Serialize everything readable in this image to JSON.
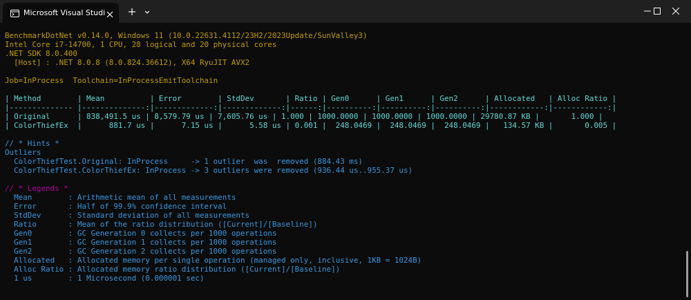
{
  "window": {
    "tab_title": "Microsoft Visual Studio デバッグ",
    "colors": {
      "titlebar": "#202020",
      "background": "#0c0c0c"
    }
  },
  "terminal": {
    "header_lines": [
      "BenchmarkDotNet v0.14.0, Windows 11 (10.0.22631.4112/23H2/2023Update/SunValley3)",
      "Intel Core i7-14700, 1 CPU, 28 logical and 20 physical cores",
      ".NET SDK 8.0.400",
      "  [Host] : .NET 8.0.8 (8.0.824.36612), X64 RyuJIT AVX2"
    ],
    "job_line": "Job=InProcess  Toolchain=InProcessEmitToolchain",
    "table_lines": [
      "| Method        | Mean          | Error        | StdDev       | Ratio | Gen0      | Gen1      | Gen2      | Allocated   | Alloc Ratio |",
      "|-------------- |--------------:|-------------:|-------------:|------:|----------:|----------:|----------:|------------:|------------:|",
      "| Original      | 838,491.5 us | 8,579.79 us | 7,605.76 us | 1.000 | 1000.0000 | 1000.0000 | 1000.0000 | 29780.87 KB |       1.000 |",
      "| ColorThiefEx  |      881.7 us |      7.15 us |      5.58 us | 0.001 |  248.0469 |  248.0469 |  248.0469 |   134.57 KB |       0.005 |"
    ],
    "hints_header": "// * Hints *",
    "outliers_label": "Outliers",
    "outlier_lines": [
      "  ColorThiefTest.Original: InProcess     -> 1 outlier  was  removed (884.43 ms)",
      "  ColorThiefTest.ColorThiefEx: InProcess -> 3 outliers were removed (936.44 us..955.37 us)"
    ],
    "legends_header": "// * Legends *",
    "legend_lines": [
      "  Mean        : Arithmetic mean of all measurements",
      "  Error       : Half of 99.9% confidence interval",
      "  StdDev      : Standard deviation of all measurements",
      "  Ratio       : Mean of the ratio distribution ([Current]/[Baseline])",
      "  Gen0        : GC Generation 0 collects per 1000 operations",
      "  Gen1        : GC Generation 1 collects per 1000 operations",
      "  Gen2        : GC Generation 2 collects per 1000 operations",
      "  Allocated   : Allocated memory per single operation (managed only, inclusive, 1KB = 1024B)",
      "  Alloc Ratio : Allocated memory ratio distribution ([Current]/[Baseline])",
      "  1 us        : 1 Microsecond (0.000001 sec)"
    ],
    "colors": {
      "yellow": "#c19c00",
      "cyan": "#3a96dd",
      "teal": "#61d6d6",
      "green": "#16c60c",
      "magenta": "#b4009e",
      "blue": "#3b78ff"
    }
  },
  "icons": {
    "tab_icon": "terminal-icon",
    "close": "close-icon",
    "new_tab": "plus-icon",
    "dropdown": "chevron-down-icon",
    "minimize": "minimize-icon",
    "maximize": "maximize-icon",
    "window_close": "close-icon"
  }
}
